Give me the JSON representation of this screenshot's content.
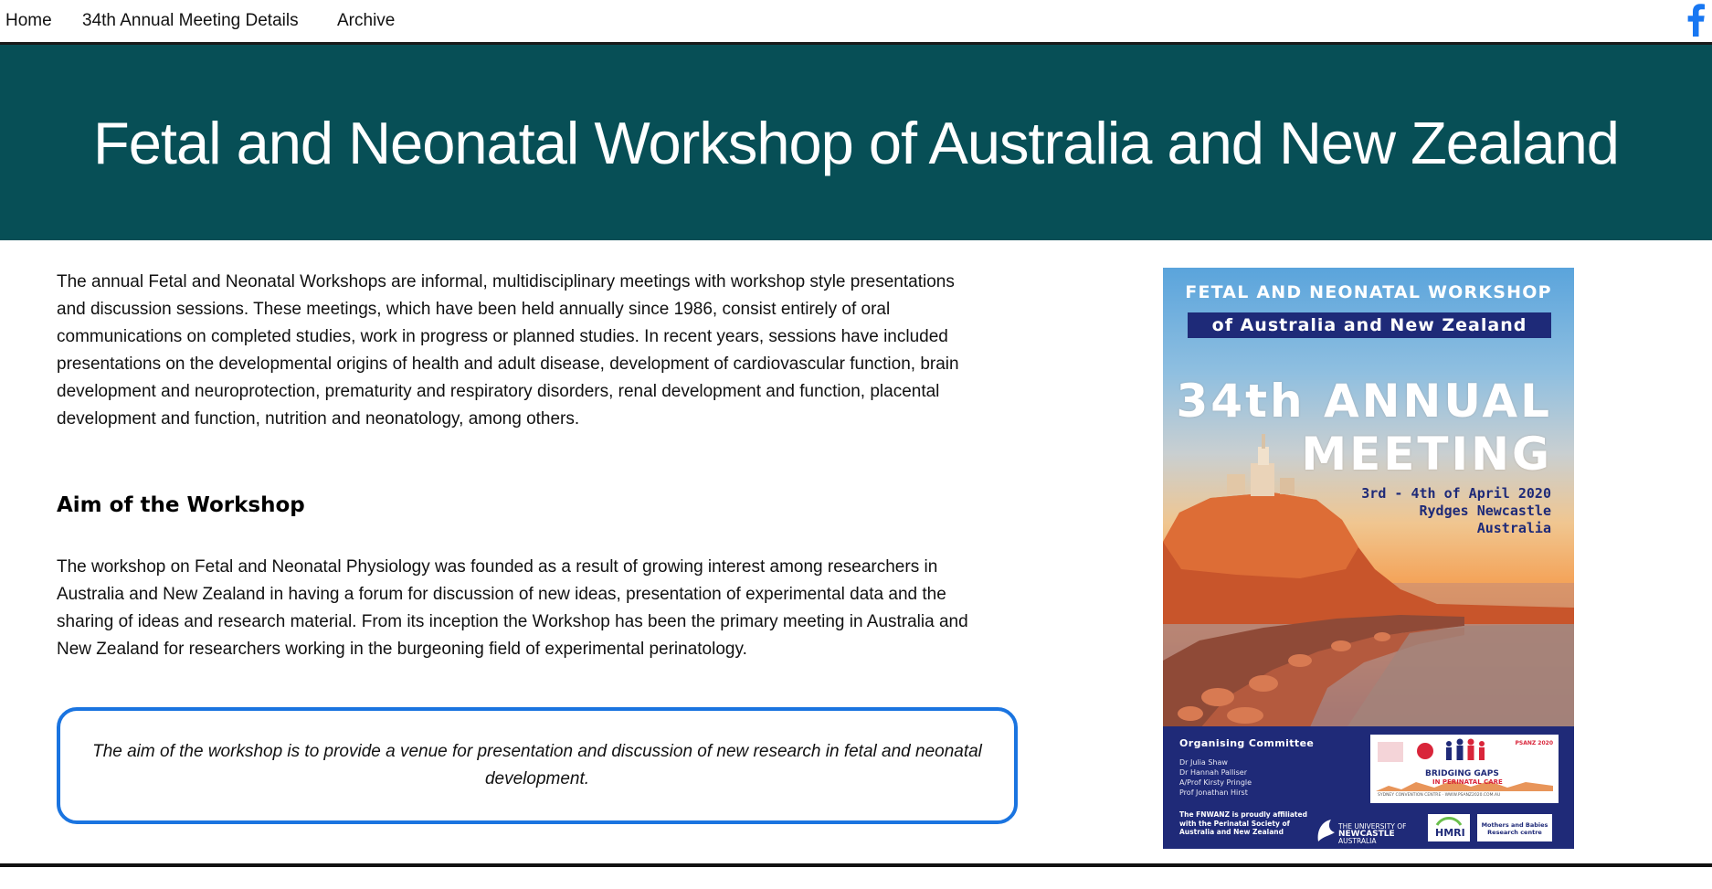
{
  "nav": {
    "items": [
      "Home",
      "34th Annual Meeting Details",
      "Archive"
    ],
    "social_icon": "facebook-icon",
    "social_color": "#1877f2"
  },
  "banner": {
    "title": "Fetal and Neonatal Workshop of Australia and New Zealand",
    "background": "#074f56"
  },
  "intro": {
    "text": "The annual Fetal and Neonatal Workshops are informal, multidisciplinary meetings with workshop style presentations and discussion sessions. These meetings, which have been held annually since 1986, consist entirely of oral communications on completed studies, work in progress or planned studies. In recent years, sessions have included presentations on the developmental origins of health and adult disease, development of cardiovascular function, brain development and neuroprotection, prematurity and respiratory disorders, renal development and function, placental development and function, nutrition and neonatology, among others."
  },
  "aim": {
    "heading": "Aim of the Workshop",
    "text": "The workshop on Fetal and Neonatal Physiology was founded as a result of growing interest among researchers in Australia and New Zealand in having a forum for discussion of new ideas, presentation of experimental data and the sharing of ideas and research material. From its inception the Workshop has been the primary meeting in Australia and New Zealand for researchers working in the burgeoning field of experimental perinatology.",
    "callout": "The aim of the workshop is to provide a venue for presentation and discussion of new research in fetal and neonatal development.",
    "callout_border": "#1a74e0"
  },
  "poster": {
    "top_line": "FETAL AND NEONATAL WORKSHOP",
    "bar_line": "of Australia and New Zealand",
    "big_line_1": "34th ANNUAL",
    "big_line_2": "MEETING",
    "date_line_1": "3rd - 4th of April 2020",
    "date_line_2": "Rydges Newcastle",
    "date_line_3": "Australia",
    "committee_title": "Organising Committee",
    "committee": [
      "Dr Julia Shaw",
      "Dr Hannah Palliser",
      "A/Prof Kirsty Pringle",
      "Prof Jonathan Hirst"
    ],
    "affiliation": "The FNWANZ is proudly affiliated with the Perinatal Society of Australia and New Zealand",
    "psanz_title": "BRIDGING GAPS",
    "psanz_subtitle": "IN PERINATAL CARE",
    "psanz_corner": "PSANZ 2020",
    "psanz_footer": "SYDNEY CONVENTION CENTRE · WWW.PSANZ2020.COM.AU",
    "uon_line_1": "THE UNIVERSITY OF",
    "uon_line_2": "NEWCASTLE",
    "uon_line_3": "AUSTRALIA",
    "hmri": "HMRI",
    "mbrc": "Mothers and Babies Research centre",
    "navy": "#1e2a78"
  }
}
